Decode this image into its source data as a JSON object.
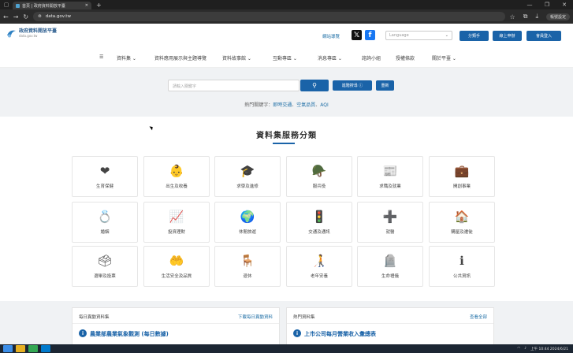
{
  "browser": {
    "tab_title": "首頁 | 政府資料開放平臺",
    "url": "data.gov.tw",
    "profile_label": "帳號設定",
    "window_controls": [
      "—",
      "❐",
      "✕"
    ]
  },
  "header": {
    "logo_title": "政府資料開放平臺",
    "logo_sub": "data.gov.tw",
    "site_guide": "網站導覽",
    "language_placeholder": "Language",
    "buttons": [
      "分類手",
      "線上申辦",
      "會員登入"
    ]
  },
  "nav": {
    "menu_icon": "☰",
    "items": [
      "資料集",
      "資料應用展示與主題導覽",
      "資料故事館",
      "互動專區",
      "消息專區",
      "諮詢小組",
      "授權條款",
      "關於平臺"
    ]
  },
  "search": {
    "placeholder": "請輸入關鍵字",
    "search_icon": "🔍",
    "advanced_label": "進階搜尋",
    "reset_label": "重新",
    "hot_prefix": "熱門關鍵字：",
    "hot_keywords": [
      "即時交通",
      "空氣品質",
      "AQI"
    ],
    "hot_sep": "、"
  },
  "categories_title": "資料集服務分類",
  "categories": [
    {
      "label": "生育保健",
      "icon": "❤"
    },
    {
      "label": "出生及收養",
      "icon": "👶"
    },
    {
      "label": "求學及進修",
      "icon": "🎓"
    },
    {
      "label": "服兵役",
      "icon": "🪖"
    },
    {
      "label": "求職及就業",
      "icon": "📰"
    },
    {
      "label": "開創事業",
      "icon": "💼"
    },
    {
      "label": "婚姻",
      "icon": "💍"
    },
    {
      "label": "投資理財",
      "icon": "📈"
    },
    {
      "label": "休閒旅遊",
      "icon": "🌍"
    },
    {
      "label": "交通及通訊",
      "icon": "🚦"
    },
    {
      "label": "就醫",
      "icon": "➕"
    },
    {
      "label": "購屋及遷徙",
      "icon": "🏠"
    },
    {
      "label": "選舉及投票",
      "icon": "🗳"
    },
    {
      "label": "生活安全及品質",
      "icon": "🤲"
    },
    {
      "label": "退休",
      "icon": "🪑"
    },
    {
      "label": "老年安養",
      "icon": "🧑‍🦯"
    },
    {
      "label": "生命禮儀",
      "icon": "🪦"
    },
    {
      "label": "公共資訊",
      "icon": "ℹ"
    }
  ],
  "panels": [
    {
      "heading": "每日異動資料集",
      "link": "下載每日異動資料",
      "item": "農業部農業氣象觀測 (每日數據)"
    },
    {
      "heading": "熱門資料集",
      "link": "查看全部",
      "item": "上市公司每月營業收入彙總表"
    }
  ],
  "taskbar": {
    "time": "上午 10:44",
    "date": "2024/6/21"
  }
}
